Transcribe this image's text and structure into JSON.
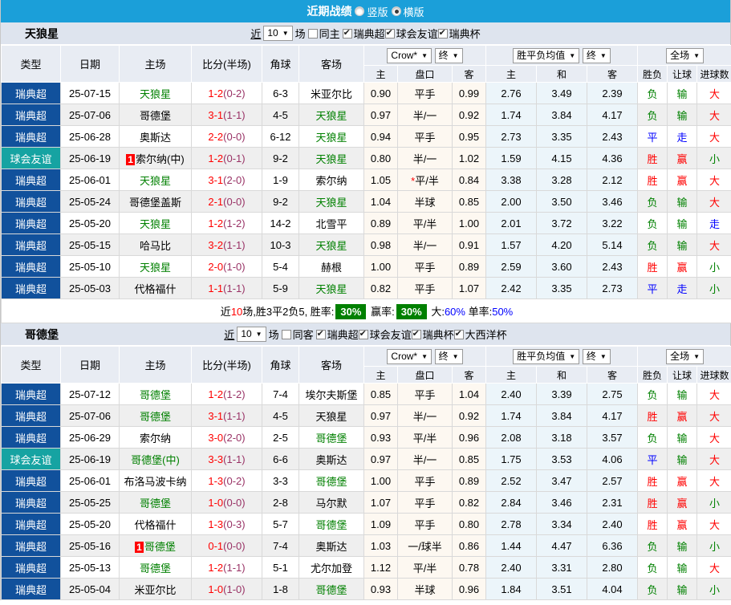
{
  "page": {
    "title": "近期战绩",
    "radios": [
      {
        "label": "竖版",
        "checked": false
      },
      {
        "label": "横版",
        "checked": true
      }
    ]
  },
  "tables": [
    {
      "team": "天狼星",
      "filter": {
        "near": "近",
        "count": "10",
        "unit": "场",
        "same": "同主",
        "same_checked": false,
        "leagues": [
          {
            "label": "瑞典超",
            "checked": true
          },
          {
            "label": "球会友谊",
            "checked": true
          },
          {
            "label": "瑞典杯",
            "checked": true
          }
        ]
      },
      "header": {
        "type": "类型",
        "date": "日期",
        "home": "主场",
        "score": "比分(半场)",
        "corner": "角球",
        "away": "客场",
        "company": "Crow*",
        "stage": "终",
        "avg": "胜平负均值",
        "stage2": "终",
        "full": "全场",
        "sub": [
          "主",
          "盘口",
          "客",
          "主",
          "和",
          "客",
          "胜负",
          "让球",
          "进球数"
        ]
      },
      "rows": [
        {
          "league": "瑞典超",
          "lt": "l",
          "date": "25-07-15",
          "home": "天狼星",
          "home_self": true,
          "home_badge": "",
          "ft": "1-2",
          "ht": "(0-2)",
          "corner": "6-3",
          "away": "米亚尔比",
          "away_self": false,
          "o1": "0.90",
          "line": "平手",
          "line_star": false,
          "o2": "0.99",
          "a1": "2.76",
          "a2": "3.49",
          "a3": "2.39",
          "r1": [
            "负",
            "green"
          ],
          "r2": [
            "输",
            "green"
          ],
          "r3": [
            "大",
            "red"
          ]
        },
        {
          "league": "瑞典超",
          "lt": "l",
          "date": "25-07-06",
          "home": "哥德堡",
          "home_self": false,
          "home_badge": "",
          "ft": "3-1",
          "ht": "(1-1)",
          "corner": "4-5",
          "away": "天狼星",
          "away_self": true,
          "o1": "0.97",
          "line": "半/一",
          "line_star": false,
          "o2": "0.92",
          "a1": "1.74",
          "a2": "3.84",
          "a3": "4.17",
          "r1": [
            "负",
            "green"
          ],
          "r2": [
            "输",
            "green"
          ],
          "r3": [
            "大",
            "red"
          ]
        },
        {
          "league": "瑞典超",
          "lt": "l",
          "date": "25-06-28",
          "home": "奥斯达",
          "home_self": false,
          "home_badge": "",
          "ft": "2-2",
          "ht": "(0-0)",
          "corner": "6-12",
          "away": "天狼星",
          "away_self": true,
          "o1": "0.94",
          "line": "平手",
          "line_star": false,
          "o2": "0.95",
          "a1": "2.73",
          "a2": "3.35",
          "a3": "2.43",
          "r1": [
            "平",
            "blue"
          ],
          "r2": [
            "走",
            "blue"
          ],
          "r3": [
            "大",
            "red"
          ]
        },
        {
          "league": "球会友谊",
          "lt": "f",
          "date": "25-06-19",
          "home": "索尔纳(中)",
          "home_self": false,
          "home_badge": "1",
          "ft": "1-2",
          "ht": "(0-1)",
          "corner": "9-2",
          "away": "天狼星",
          "away_self": true,
          "o1": "0.80",
          "line": "半/一",
          "line_star": false,
          "o2": "1.02",
          "a1": "1.59",
          "a2": "4.15",
          "a3": "4.36",
          "r1": [
            "胜",
            "red"
          ],
          "r2": [
            "赢",
            "red"
          ],
          "r3": [
            "小",
            "green"
          ]
        },
        {
          "league": "瑞典超",
          "lt": "l",
          "date": "25-06-01",
          "home": "天狼星",
          "home_self": true,
          "home_badge": "",
          "ft": "3-1",
          "ht": "(2-0)",
          "corner": "1-9",
          "away": "索尔纳",
          "away_self": false,
          "o1": "1.05",
          "line": "平/半",
          "line_star": true,
          "o2": "0.84",
          "a1": "3.38",
          "a2": "3.28",
          "a3": "2.12",
          "r1": [
            "胜",
            "red"
          ],
          "r2": [
            "赢",
            "red"
          ],
          "r3": [
            "大",
            "red"
          ]
        },
        {
          "league": "瑞典超",
          "lt": "l",
          "date": "25-05-24",
          "home": "哥德堡盖斯",
          "home_self": false,
          "home_badge": "",
          "ft": "2-1",
          "ht": "(0-0)",
          "corner": "9-2",
          "away": "天狼星",
          "away_self": true,
          "o1": "1.04",
          "line": "半球",
          "line_star": false,
          "o2": "0.85",
          "a1": "2.00",
          "a2": "3.50",
          "a3": "3.46",
          "r1": [
            "负",
            "green"
          ],
          "r2": [
            "输",
            "green"
          ],
          "r3": [
            "大",
            "red"
          ]
        },
        {
          "league": "瑞典超",
          "lt": "l",
          "date": "25-05-20",
          "home": "天狼星",
          "home_self": true,
          "home_badge": "",
          "ft": "1-2",
          "ht": "(1-2)",
          "corner": "14-2",
          "away": "北雪平",
          "away_self": false,
          "o1": "0.89",
          "line": "平/半",
          "line_star": false,
          "o2": "1.00",
          "a1": "2.01",
          "a2": "3.72",
          "a3": "3.22",
          "r1": [
            "负",
            "green"
          ],
          "r2": [
            "输",
            "green"
          ],
          "r3": [
            "走",
            "blue"
          ]
        },
        {
          "league": "瑞典超",
          "lt": "l",
          "date": "25-05-15",
          "home": "哈马比",
          "home_self": false,
          "home_badge": "",
          "ft": "3-2",
          "ht": "(1-1)",
          "corner": "10-3",
          "away": "天狼星",
          "away_self": true,
          "o1": "0.98",
          "line": "半/一",
          "line_star": false,
          "o2": "0.91",
          "a1": "1.57",
          "a2": "4.20",
          "a3": "5.14",
          "r1": [
            "负",
            "green"
          ],
          "r2": [
            "输",
            "green"
          ],
          "r3": [
            "大",
            "red"
          ]
        },
        {
          "league": "瑞典超",
          "lt": "l",
          "date": "25-05-10",
          "home": "天狼星",
          "home_self": true,
          "home_badge": "",
          "ft": "2-0",
          "ht": "(1-0)",
          "corner": "5-4",
          "away": "赫根",
          "away_self": false,
          "o1": "1.00",
          "line": "平手",
          "line_star": false,
          "o2": "0.89",
          "a1": "2.59",
          "a2": "3.60",
          "a3": "2.43",
          "r1": [
            "胜",
            "red"
          ],
          "r2": [
            "赢",
            "red"
          ],
          "r3": [
            "小",
            "green"
          ]
        },
        {
          "league": "瑞典超",
          "lt": "l",
          "date": "25-05-03",
          "home": "代格福什",
          "home_self": false,
          "home_badge": "",
          "ft": "1-1",
          "ht": "(1-1)",
          "corner": "5-9",
          "away": "天狼星",
          "away_self": true,
          "o1": "0.82",
          "line": "平手",
          "line_star": false,
          "o2": "1.07",
          "a1": "2.42",
          "a2": "3.35",
          "a3": "2.73",
          "r1": [
            "平",
            "blue"
          ],
          "r2": [
            "走",
            "blue"
          ],
          "r3": [
            "小",
            "green"
          ]
        }
      ],
      "summary": [
        {
          "text": "近",
          "style": ""
        },
        {
          "text": "10",
          "style": "red"
        },
        {
          "text": "场,胜3平2负5, 胜率:",
          "style": ""
        },
        {
          "text": "30%",
          "style": "box"
        },
        {
          "text": " 赢率:",
          "style": ""
        },
        {
          "text": "30%",
          "style": "box"
        },
        {
          "text": " 大:",
          "style": ""
        },
        {
          "text": "60%",
          "style": "blue"
        },
        {
          "text": " 单率:",
          "style": ""
        },
        {
          "text": "50%",
          "style": "blue"
        }
      ]
    },
    {
      "team": "哥德堡",
      "filter": {
        "near": "近",
        "count": "10",
        "unit": "场",
        "same": "同客",
        "same_checked": false,
        "leagues": [
          {
            "label": "瑞典超",
            "checked": true
          },
          {
            "label": "球会友谊",
            "checked": true
          },
          {
            "label": "瑞典杯",
            "checked": true
          },
          {
            "label": "大西洋杯",
            "checked": true
          }
        ]
      },
      "header": {
        "type": "类型",
        "date": "日期",
        "home": "主场",
        "score": "比分(半场)",
        "corner": "角球",
        "away": "客场",
        "company": "Crow*",
        "stage": "终",
        "avg": "胜平负均值",
        "stage2": "终",
        "full": "全场",
        "sub": [
          "主",
          "盘口",
          "客",
          "主",
          "和",
          "客",
          "胜负",
          "让球",
          "进球数"
        ]
      },
      "rows": [
        {
          "league": "瑞典超",
          "lt": "l",
          "date": "25-07-12",
          "home": "哥德堡",
          "home_self": true,
          "home_badge": "",
          "ft": "1-2",
          "ht": "(1-2)",
          "corner": "7-4",
          "away": "埃尔夫斯堡",
          "away_self": false,
          "o1": "0.85",
          "line": "平手",
          "line_star": false,
          "o2": "1.04",
          "a1": "2.40",
          "a2": "3.39",
          "a3": "2.75",
          "r1": [
            "负",
            "green"
          ],
          "r2": [
            "输",
            "green"
          ],
          "r3": [
            "大",
            "red"
          ]
        },
        {
          "league": "瑞典超",
          "lt": "l",
          "date": "25-07-06",
          "home": "哥德堡",
          "home_self": true,
          "home_badge": "",
          "ft": "3-1",
          "ht": "(1-1)",
          "corner": "4-5",
          "away": "天狼星",
          "away_self": false,
          "o1": "0.97",
          "line": "半/一",
          "line_star": false,
          "o2": "0.92",
          "a1": "1.74",
          "a2": "3.84",
          "a3": "4.17",
          "r1": [
            "胜",
            "red"
          ],
          "r2": [
            "赢",
            "red"
          ],
          "r3": [
            "大",
            "red"
          ]
        },
        {
          "league": "瑞典超",
          "lt": "l",
          "date": "25-06-29",
          "home": "索尔纳",
          "home_self": false,
          "home_badge": "",
          "ft": "3-0",
          "ht": "(2-0)",
          "corner": "2-5",
          "away": "哥德堡",
          "away_self": true,
          "o1": "0.93",
          "line": "平/半",
          "line_star": false,
          "o2": "0.96",
          "a1": "2.08",
          "a2": "3.18",
          "a3": "3.57",
          "r1": [
            "负",
            "green"
          ],
          "r2": [
            "输",
            "green"
          ],
          "r3": [
            "大",
            "red"
          ]
        },
        {
          "league": "球会友谊",
          "lt": "f",
          "date": "25-06-19",
          "home": "哥德堡(中)",
          "home_self": true,
          "home_badge": "",
          "ft": "3-3",
          "ht": "(1-1)",
          "corner": "6-6",
          "away": "奥斯达",
          "away_self": false,
          "o1": "0.97",
          "line": "半/一",
          "line_star": false,
          "o2": "0.85",
          "a1": "1.75",
          "a2": "3.53",
          "a3": "4.06",
          "r1": [
            "平",
            "blue"
          ],
          "r2": [
            "输",
            "green"
          ],
          "r3": [
            "大",
            "red"
          ]
        },
        {
          "league": "瑞典超",
          "lt": "l",
          "date": "25-06-01",
          "home": "布洛马波卡纳",
          "home_self": false,
          "home_badge": "",
          "ft": "1-3",
          "ht": "(0-2)",
          "corner": "3-3",
          "away": "哥德堡",
          "away_self": true,
          "o1": "1.00",
          "line": "平手",
          "line_star": false,
          "o2": "0.89",
          "a1": "2.52",
          "a2": "3.47",
          "a3": "2.57",
          "r1": [
            "胜",
            "red"
          ],
          "r2": [
            "赢",
            "red"
          ],
          "r3": [
            "大",
            "red"
          ]
        },
        {
          "league": "瑞典超",
          "lt": "l",
          "date": "25-05-25",
          "home": "哥德堡",
          "home_self": true,
          "home_badge": "",
          "ft": "1-0",
          "ht": "(0-0)",
          "corner": "2-8",
          "away": "马尔默",
          "away_self": false,
          "o1": "1.07",
          "line": "平手",
          "line_star": false,
          "o2": "0.82",
          "a1": "2.84",
          "a2": "3.46",
          "a3": "2.31",
          "r1": [
            "胜",
            "red"
          ],
          "r2": [
            "赢",
            "red"
          ],
          "r3": [
            "小",
            "green"
          ]
        },
        {
          "league": "瑞典超",
          "lt": "l",
          "date": "25-05-20",
          "home": "代格福什",
          "home_self": false,
          "home_badge": "",
          "ft": "1-3",
          "ht": "(0-3)",
          "corner": "5-7",
          "away": "哥德堡",
          "away_self": true,
          "o1": "1.09",
          "line": "平手",
          "line_star": false,
          "o2": "0.80",
          "a1": "2.78",
          "a2": "3.34",
          "a3": "2.40",
          "r1": [
            "胜",
            "red"
          ],
          "r2": [
            "赢",
            "red"
          ],
          "r3": [
            "大",
            "red"
          ]
        },
        {
          "league": "瑞典超",
          "lt": "l",
          "date": "25-05-16",
          "home": "哥德堡",
          "home_self": true,
          "home_badge": "1",
          "ft": "0-1",
          "ht": "(0-0)",
          "corner": "7-4",
          "away": "奥斯达",
          "away_self": false,
          "o1": "1.03",
          "line": "一/球半",
          "line_star": false,
          "o2": "0.86",
          "a1": "1.44",
          "a2": "4.47",
          "a3": "6.36",
          "r1": [
            "负",
            "green"
          ],
          "r2": [
            "输",
            "green"
          ],
          "r3": [
            "小",
            "green"
          ]
        },
        {
          "league": "瑞典超",
          "lt": "l",
          "date": "25-05-13",
          "home": "哥德堡",
          "home_self": true,
          "home_badge": "",
          "ft": "1-2",
          "ht": "(1-1)",
          "corner": "5-1",
          "away": "尤尔加登",
          "away_self": false,
          "o1": "1.12",
          "line": "平/半",
          "line_star": false,
          "o2": "0.78",
          "a1": "2.40",
          "a2": "3.31",
          "a3": "2.80",
          "r1": [
            "负",
            "green"
          ],
          "r2": [
            "输",
            "green"
          ],
          "r3": [
            "大",
            "red"
          ]
        },
        {
          "league": "瑞典超",
          "lt": "l",
          "date": "25-05-04",
          "home": "米亚尔比",
          "home_self": false,
          "home_badge": "",
          "ft": "1-0",
          "ht": "(1-0)",
          "corner": "1-8",
          "away": "哥德堡",
          "away_self": true,
          "o1": "0.93",
          "line": "半球",
          "line_star": false,
          "o2": "0.96",
          "a1": "1.84",
          "a2": "3.51",
          "a3": "4.04",
          "r1": [
            "负",
            "green"
          ],
          "r2": [
            "输",
            "green"
          ],
          "r3": [
            "小",
            "green"
          ]
        }
      ],
      "summary": null
    }
  ]
}
